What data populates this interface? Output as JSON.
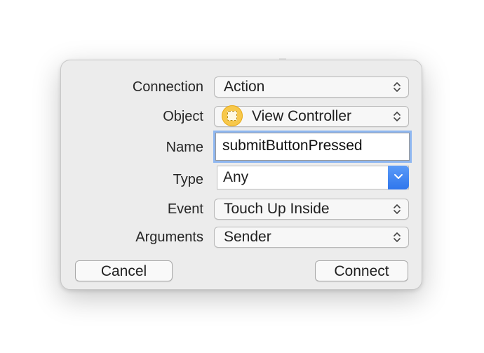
{
  "dialog": {
    "fields": {
      "connection": {
        "label": "Connection",
        "value": "Action"
      },
      "object": {
        "label": "Object",
        "value": "View Controller"
      },
      "name": {
        "label": "Name",
        "value": "submitButtonPressed"
      },
      "type": {
        "label": "Type",
        "value": "Any"
      },
      "event": {
        "label": "Event",
        "value": "Touch Up Inside"
      },
      "arguments": {
        "label": "Arguments",
        "value": "Sender"
      }
    },
    "buttons": {
      "cancel": "Cancel",
      "connect": "Connect"
    }
  },
  "colors": {
    "focus_ring": "#8fb7f0",
    "dropdown_accent": "#3a82f0",
    "object_icon": "#f7c84b"
  },
  "icons": {
    "popup_indicator": "up-down-chevron-icon",
    "combo_indicator": "chevron-down-icon",
    "object": "view-controller-icon"
  }
}
